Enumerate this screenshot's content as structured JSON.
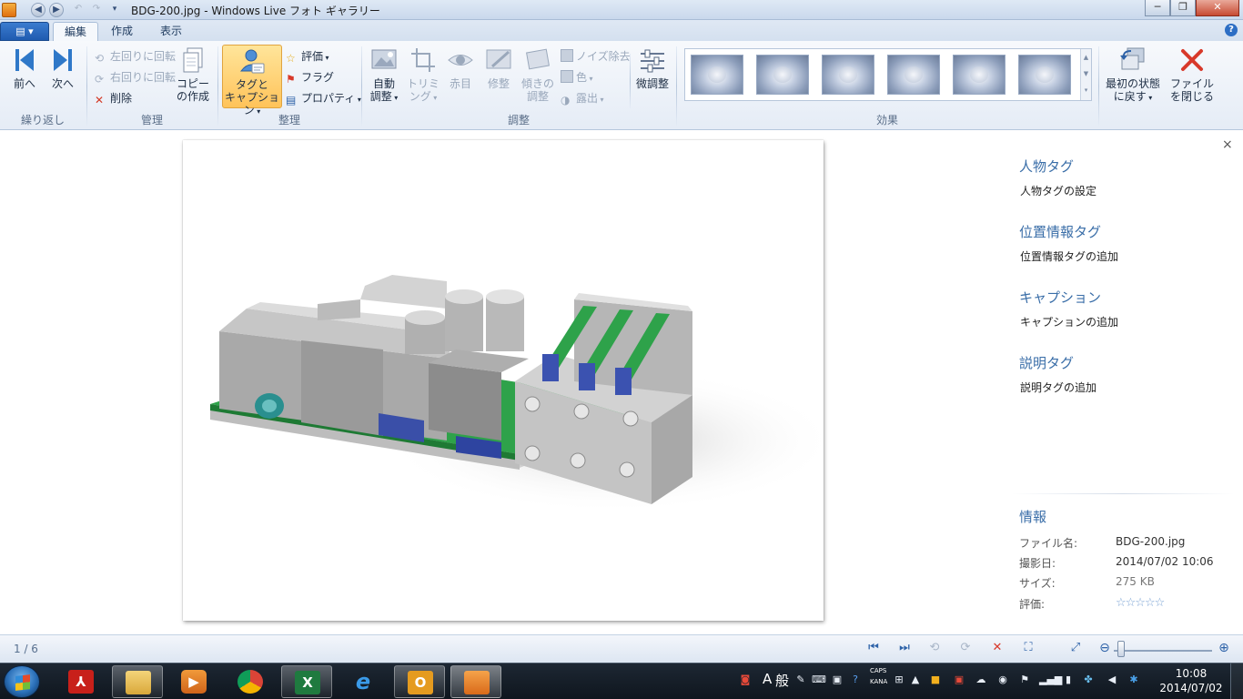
{
  "window": {
    "title": "BDG-200.jpg - Windows Live フォト ギャラリー",
    "min": "─",
    "max": "❐",
    "close": "✕"
  },
  "tabs": {
    "file_menu": "▤ ▾",
    "items": [
      {
        "label": "編集",
        "active": true
      },
      {
        "label": "作成",
        "active": false
      },
      {
        "label": "表示",
        "active": false
      }
    ],
    "help": "?"
  },
  "ribbon": {
    "browse": {
      "prev": "前へ",
      "next": "次へ",
      "group": "繰り返し"
    },
    "manage": {
      "rotate_left": "左回りに回転",
      "rotate_right": "右回りに回転",
      "delete": "削除",
      "copy_line1": "コピー",
      "copy_line2": "の作成",
      "group": "管理"
    },
    "organize": {
      "tag_line1": "タグと",
      "tag_line2": "キャプション",
      "rating": "評価",
      "flag": "フラグ",
      "properties": "プロパティ",
      "group": "整理"
    },
    "adjust": {
      "auto_line1": "自動",
      "auto_line2": "調整",
      "crop_line1": "トリミ",
      "crop_line2": "ング",
      "redeye": "赤目",
      "retouch": "修整",
      "straighten_line1": "傾きの",
      "straighten_line2": "調整",
      "noise": "ノイズ除去",
      "color": "色",
      "exposure": "露出",
      "fine_tune": "微調整",
      "group": "調整"
    },
    "effects": {
      "group": "効果",
      "count": 6
    },
    "revert_line1": "最初の状態",
    "revert_line2": "に戻す",
    "close_line1": "ファイル",
    "close_line2": "を閉じる"
  },
  "info_pane": {
    "close": "×",
    "people_tag": "人物タグ",
    "people_tag_action": "人物タグの設定",
    "geo_tag": "位置情報タグ",
    "geo_tag_action": "位置情報タグの追加",
    "caption": "キャプション",
    "caption_action": "キャプションの追加",
    "desc_tag": "説明タグ",
    "desc_tag_action": "説明タグの追加",
    "info_header": "情報",
    "filename_label": "ファイル名:",
    "filename": "BDG-200.jpg",
    "date_label": "撮影日:",
    "date": "2014/07/02  10:06",
    "size_label": "サイズ:",
    "size": "275 KB",
    "rating_label": "評価:",
    "rating_stars": "☆☆☆☆☆",
    "rating_value": 0
  },
  "statusbar": {
    "page": "1 / 6"
  },
  "taskbar": {
    "ime_mode": "A",
    "ime_general": "般",
    "caps": "CAPS",
    "kana": "KANA",
    "time": "10:08",
    "date": "2014/07/02"
  },
  "colors": {
    "accent": "#3a6ea8",
    "ribbon_bg": "#e5ecf6",
    "pcb_green": "#2ea24a",
    "taskbar": "#141c26"
  }
}
